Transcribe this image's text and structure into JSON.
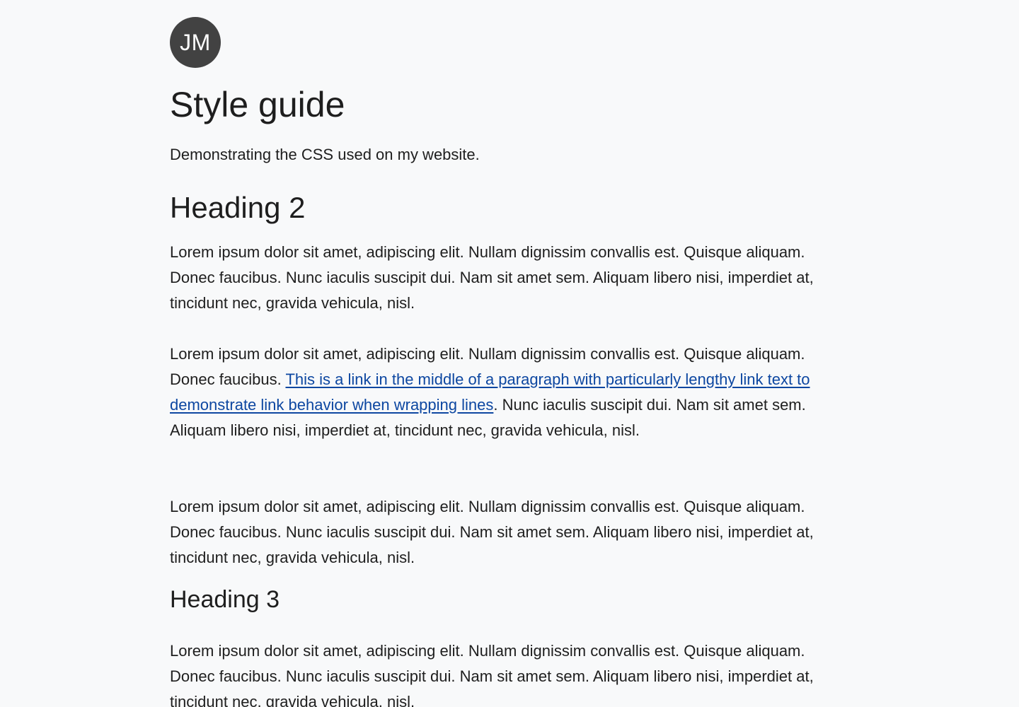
{
  "header": {
    "avatar_initials": "JM"
  },
  "main": {
    "title": "Style guide",
    "subtitle": "Demonstrating the CSS used on my website.",
    "heading2": "Heading 2",
    "heading3": "Heading 3",
    "paragraph1": "Lorem ipsum dolor sit amet, adipiscing elit. Nullam dignissim convallis est. Quisque aliquam. Donec faucibus. Nunc iaculis suscipit dui. Nam sit amet sem. Aliquam libero nisi, imperdiet at, tincidunt nec, gravida vehicula, nisl.",
    "paragraph2": {
      "before": "Lorem ipsum dolor sit amet, adipiscing elit. Nullam dignissim convallis est. Quisque aliquam. Donec faucibus. ",
      "link": "This is a link in the middle of a paragraph with particularly lengthy link text to demonstrate link behavior when wrapping lines",
      "after": ". Nunc iaculis suscipit dui. Nam sit amet sem. Aliquam libero nisi, imperdiet at, tincidunt nec, gravida vehicula, nisl."
    },
    "paragraph3": "Lorem ipsum dolor sit amet, adipiscing elit. Nullam dignissim convallis est. Quisque aliquam. Donec faucibus. Nunc iaculis suscipit dui. Nam sit amet sem. Aliquam libero nisi, imperdiet at, tincidunt nec, gravida vehicula, nisl.",
    "paragraph4": "Lorem ipsum dolor sit amet, adipiscing elit. Nullam dignissim convallis est. Quisque aliquam. Donec faucibus. Nunc iaculis suscipit dui. Nam sit amet sem. Aliquam libero nisi, imperdiet at, tincidunt nec, gravida vehicula, nisl."
  },
  "colors": {
    "background": "#f8f9fa",
    "text": "#1e1e1e",
    "avatar_bg": "#424242",
    "link": "#0d47a1"
  }
}
